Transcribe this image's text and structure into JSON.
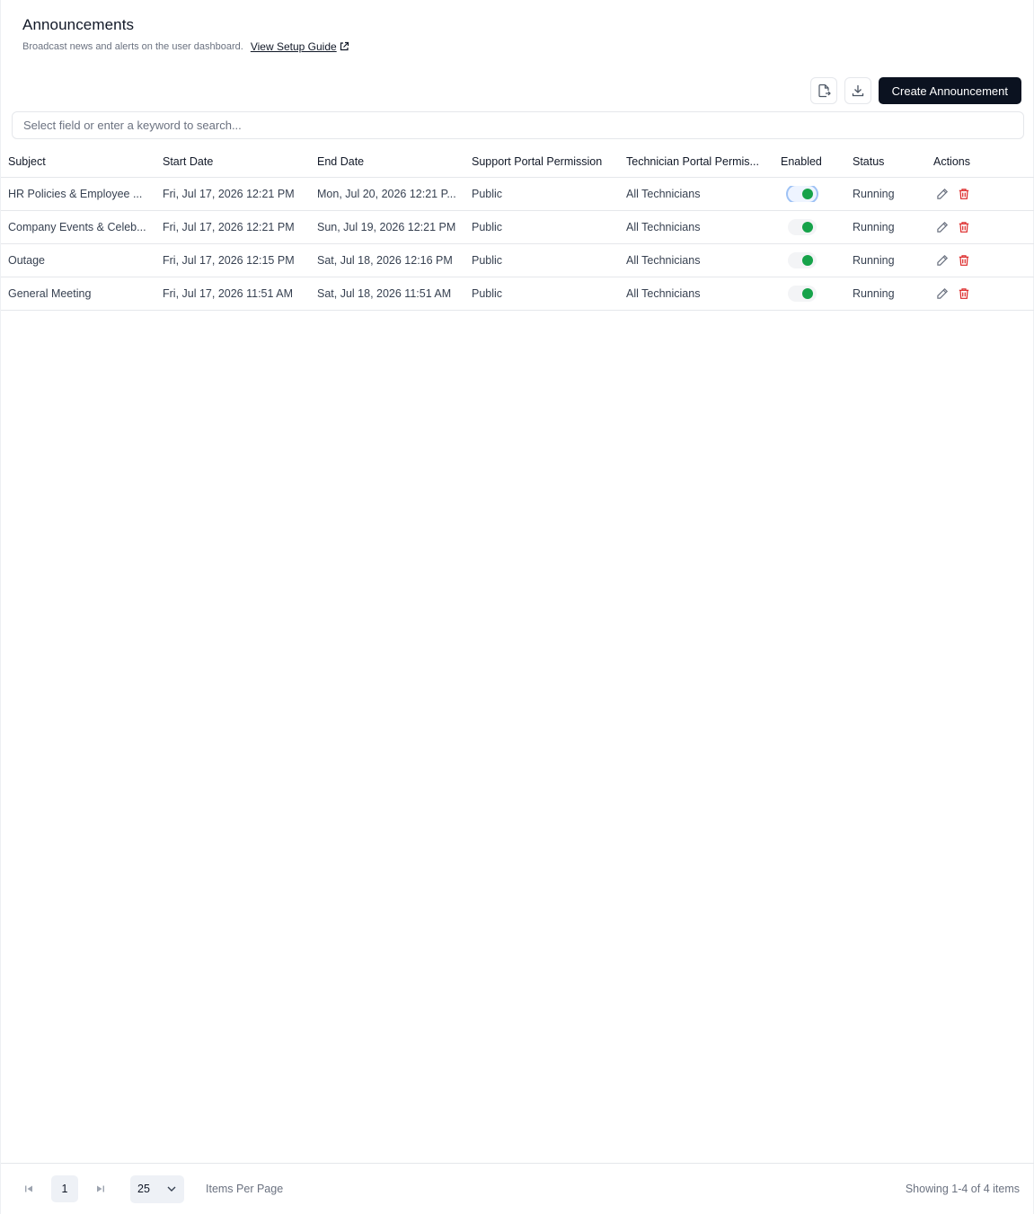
{
  "header": {
    "title": "Announcements",
    "subtitle": "Broadcast news and alerts on the user dashboard.",
    "guide_link": "View Setup Guide"
  },
  "toolbar": {
    "export_icon": "file-export-icon",
    "download_icon": "download-icon",
    "create_label": "Create Announcement"
  },
  "search": {
    "placeholder": "Select field or enter a keyword to search...",
    "value": ""
  },
  "table": {
    "columns": [
      "Subject",
      "Start Date",
      "End Date",
      "Support Portal Permission",
      "Technician Portal Permis...",
      "Enabled",
      "Status",
      "Actions"
    ],
    "rows": [
      {
        "subject": "HR Policies & Employee ...",
        "start": "Fri, Jul 17, 2026 12:21 PM",
        "end": "Mon, Jul 20, 2026 12:21 P...",
        "support": "Public",
        "tech": "All Technicians",
        "enabled": true,
        "status": "Running"
      },
      {
        "subject": "Company Events & Celeb...",
        "start": "Fri, Jul 17, 2026 12:21 PM",
        "end": "Sun, Jul 19, 2026 12:21 PM",
        "support": "Public",
        "tech": "All Technicians",
        "enabled": true,
        "status": "Running"
      },
      {
        "subject": "Outage",
        "start": "Fri, Jul 17, 2026 12:15 PM",
        "end": "Sat, Jul 18, 2026 12:16 PM",
        "support": "Public",
        "tech": "All Technicians",
        "enabled": true,
        "status": "Running"
      },
      {
        "subject": "General Meeting",
        "start": "Fri, Jul 17, 2026 11:51 AM",
        "end": "Sat, Jul 18, 2026 11:51 AM",
        "support": "Public",
        "tech": "All Technicians",
        "enabled": true,
        "status": "Running"
      }
    ]
  },
  "pagination": {
    "current_page": "1",
    "per_page": "25",
    "per_page_label": "Items Per Page",
    "showing": "Showing 1-4 of 4 items"
  },
  "colors": {
    "primary": "#0b1220",
    "toggle_on": "#16a34a",
    "delete": "#dc2626",
    "edit": "#6b7280"
  }
}
